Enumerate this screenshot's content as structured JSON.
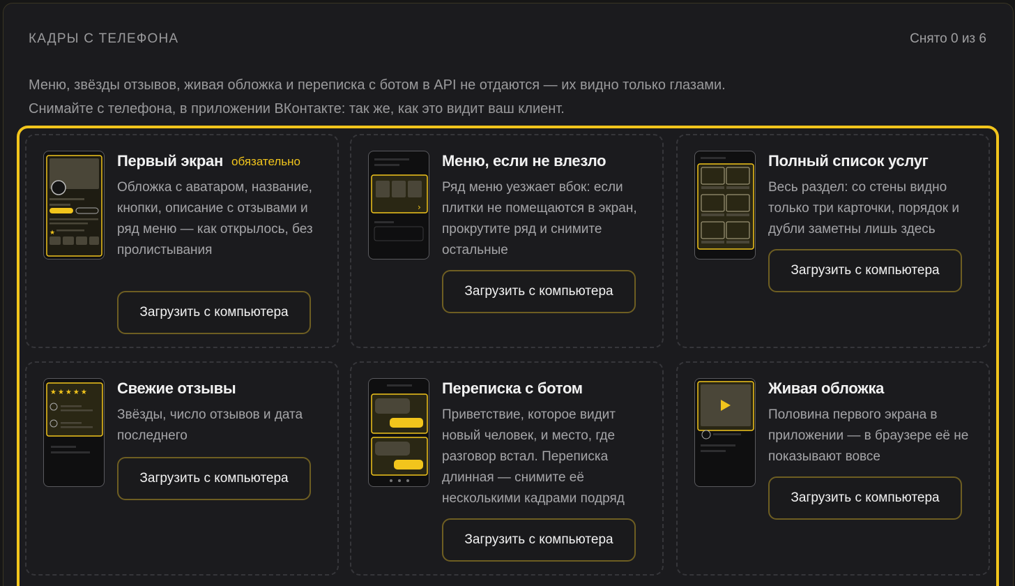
{
  "panel": {
    "title": "КАДРЫ С ТЕЛЕФОНА",
    "counter": "Снято 0 из 6",
    "intro": "Меню, звёзды отзывов, живая обложка и переписка с ботом в API не отдаются — их видно только глазами. Снимайте с телефона, в приложении ВКонтакте: так же, как это видит ваш клиент."
  },
  "accent_color": "#f2c51c",
  "cards": [
    {
      "title": "Первый экран",
      "badge": "обязательно",
      "desc": "Обложка с аватаром, название, кнопки, описание с отзывами и ряд меню — как открылось, без пролистывания",
      "button": "Загрузить с компьютера",
      "icon": "phone-first-screen-icon"
    },
    {
      "title": "Меню, если не влезло",
      "desc": "Ряд меню уезжает вбок: если плитки не помещаются в экран, прокрутите ряд и снимите остальные",
      "button": "Загрузить с компьютера",
      "icon": "phone-menu-row-icon"
    },
    {
      "title": "Полный список услуг",
      "desc": "Весь раздел: со стены видно только три карточки, порядок и дубли заметны лишь здесь",
      "button": "Загрузить с компьютера",
      "icon": "phone-services-grid-icon"
    },
    {
      "title": "Свежие отзывы",
      "desc": "Звёзды, число отзывов и дата последнего",
      "button": "Загрузить с компьютера",
      "icon": "phone-reviews-icon"
    },
    {
      "title": "Переписка с ботом",
      "desc": "Приветствие, которое видит новый человек, и место, где разговор встал. Переписка длинная — снимите её несколькими кадрами подряд",
      "button": "Загрузить с компьютера",
      "icon": "phone-chat-icon"
    },
    {
      "title": "Живая обложка",
      "desc": "Половина первого экрана в приложении — в браузере её не показывают вовсе",
      "button": "Загрузить с компьютера",
      "icon": "phone-live-cover-icon"
    }
  ]
}
